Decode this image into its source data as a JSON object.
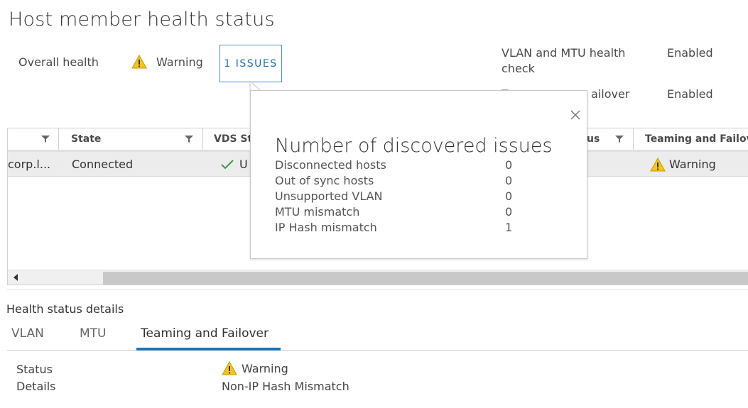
{
  "page": {
    "title": "Host member health status"
  },
  "summary": {
    "overall_label": "Overall health",
    "overall_status": "Warning",
    "issues_button": "1 ISSUES",
    "vlan_mtu_label_line1": "VLAN and MTU health",
    "vlan_mtu_label_line2": "check",
    "vlan_mtu_value": "Enabled",
    "teaming_label_partial_left": "T",
    "teaming_label_partial_right": "ailover",
    "teaming_value": "Enabled"
  },
  "grid": {
    "columns": [
      {
        "label": ""
      },
      {
        "label": "State"
      },
      {
        "label": "VDS St"
      },
      {
        "label": "us"
      },
      {
        "label": "Teaming and Failov.."
      }
    ],
    "row": {
      "host": "corp.l...",
      "state": "Connected",
      "vds_status": "U",
      "teaming": "Warning"
    }
  },
  "popover": {
    "title": "Number of discovered issues",
    "rows": [
      {
        "label": "Disconnected hosts",
        "value": "0"
      },
      {
        "label": "Out of sync hosts",
        "value": "0"
      },
      {
        "label": "Unsupported VLAN",
        "value": "0"
      },
      {
        "label": "MTU mismatch",
        "value": "0"
      },
      {
        "label": "IP Hash mismatch",
        "value": "1"
      }
    ]
  },
  "details": {
    "section_title": "Health status details",
    "tabs": [
      {
        "label": "VLAN"
      },
      {
        "label": "MTU"
      },
      {
        "label": "Teaming and Failover"
      }
    ],
    "status_label": "Status",
    "status_value": "Warning",
    "details_label": "Details",
    "details_value": "Non-IP Hash Mismatch"
  },
  "colors": {
    "accent": "#1a73b8",
    "warning": "#f5c518",
    "success": "#3c9a3c"
  },
  "icons": {
    "warning": "warning-triangle-icon",
    "check": "checkmark-icon",
    "filter": "filter-icon",
    "close": "close-icon"
  }
}
